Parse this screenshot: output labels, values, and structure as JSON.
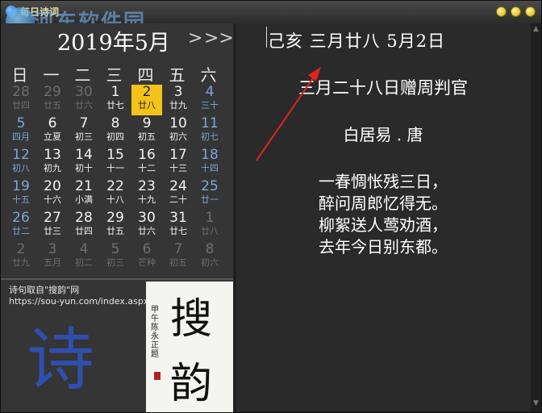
{
  "window": {
    "title": "每日诗词"
  },
  "watermark": {
    "text": "河东软件园"
  },
  "calendar": {
    "prev": "<",
    "next": ">",
    "next_fast": ">>",
    "month_title": "2019年5月",
    "weekdays": [
      "日",
      "一",
      "二",
      "三",
      "四",
      "五",
      "六"
    ],
    "weeks": [
      [
        [
          "28",
          "廿四",
          1,
          0
        ],
        [
          "29",
          "廿五",
          1,
          0
        ],
        [
          "30",
          "廿六",
          1,
          0
        ],
        [
          "1",
          "廿七",
          0,
          0
        ],
        [
          "2",
          "廿八",
          0,
          1
        ],
        [
          "3",
          "廿九",
          0,
          0
        ],
        [
          "4",
          "三十",
          0,
          0
        ]
      ],
      [
        [
          "5",
          "四月",
          0,
          0
        ],
        [
          "6",
          "立夏",
          0,
          0
        ],
        [
          "7",
          "初三",
          0,
          0
        ],
        [
          "8",
          "初四",
          0,
          0
        ],
        [
          "9",
          "初五",
          0,
          0
        ],
        [
          "10",
          "初六",
          0,
          0
        ],
        [
          "11",
          "初七",
          0,
          0
        ]
      ],
      [
        [
          "12",
          "初八",
          0,
          0
        ],
        [
          "13",
          "初九",
          0,
          0
        ],
        [
          "14",
          "初十",
          0,
          0
        ],
        [
          "15",
          "十一",
          0,
          0
        ],
        [
          "16",
          "十二",
          0,
          0
        ],
        [
          "17",
          "十三",
          0,
          0
        ],
        [
          "18",
          "十四",
          0,
          0
        ]
      ],
      [
        [
          "19",
          "十五",
          0,
          0
        ],
        [
          "20",
          "十六",
          0,
          0
        ],
        [
          "21",
          "小满",
          0,
          0
        ],
        [
          "22",
          "十八",
          0,
          0
        ],
        [
          "23",
          "十九",
          0,
          0
        ],
        [
          "24",
          "二十",
          0,
          0
        ],
        [
          "25",
          "廿一",
          0,
          0
        ]
      ],
      [
        [
          "26",
          "廿二",
          0,
          0
        ],
        [
          "27",
          "廿三",
          0,
          0
        ],
        [
          "28",
          "廿四",
          0,
          0
        ],
        [
          "29",
          "廿五",
          0,
          0
        ],
        [
          "30",
          "廿六",
          0,
          0
        ],
        [
          "31",
          "廿七",
          0,
          0
        ],
        [
          "1",
          "廿八",
          1,
          0
        ]
      ],
      [
        [
          "2",
          "廿九",
          1,
          0
        ],
        [
          "3",
          "五月",
          1,
          0
        ],
        [
          "4",
          "初二",
          1,
          0
        ],
        [
          "5",
          "初三",
          1,
          0
        ],
        [
          "6",
          "芒种",
          1,
          0
        ],
        [
          "7",
          "初五",
          1,
          0
        ],
        [
          "8",
          "初六",
          1,
          0
        ]
      ]
    ]
  },
  "source": {
    "line1": "诗句取自\"搜韵\"网",
    "line2": "https://sou-yun.com/index.aspx"
  },
  "decor": {
    "big_char": "诗",
    "calli_1": "搜",
    "calli_2": "韵",
    "calli_sig": "甲午陈永正题"
  },
  "poem": {
    "date": "己亥 三月廿八  5月2日",
    "title": "三月二十八日赠周判官",
    "author": "白居易 . 唐",
    "lines": [
      "一春惆怅残三日，",
      "醉问周郎忆得无。",
      "柳絮送人莺劝酒，",
      "去年今日别东都。"
    ]
  }
}
